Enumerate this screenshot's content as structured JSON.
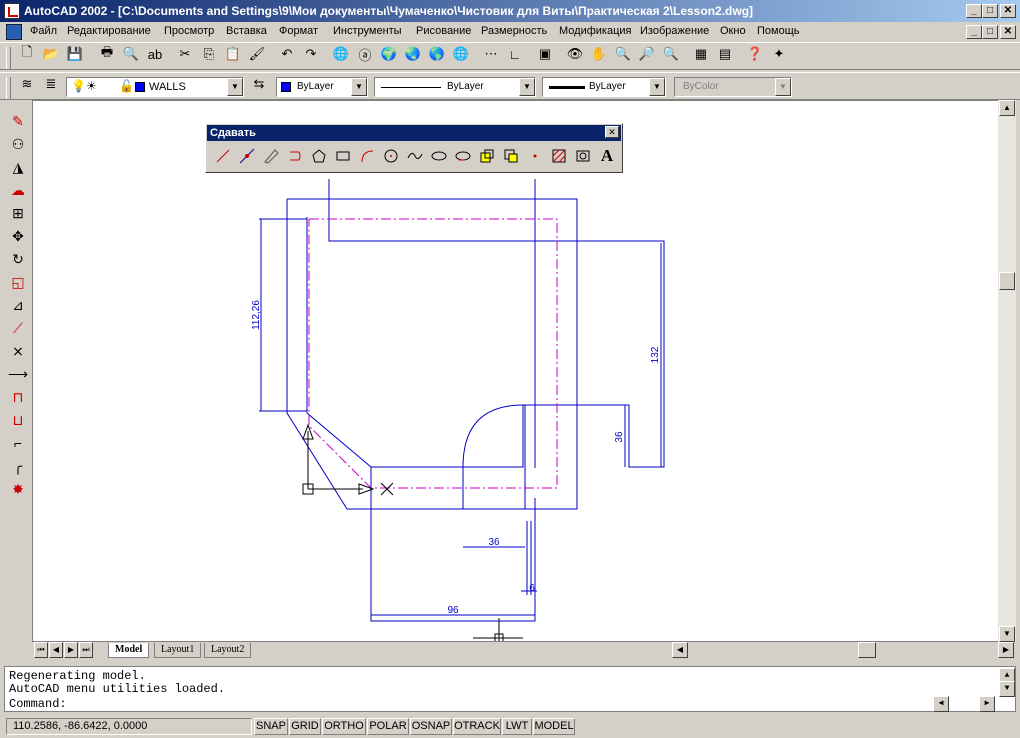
{
  "window": {
    "title": "AutoCAD 2002 - [C:\\Documents and Settings\\9\\Мои документы\\Чумаченко\\Чистовик для Виты\\Практическая 2\\Lesson2.dwg]",
    "controls": [
      "_",
      "□",
      "✕"
    ]
  },
  "menu": [
    "Файл",
    "Редактирование",
    "Просмотр",
    "Вставка",
    "Формат",
    "Инструменты",
    "Рисование",
    "Размерность",
    "Модификация",
    "Изображение",
    "Окно",
    "Помощь"
  ],
  "properties": {
    "layer": "WALLS",
    "color": "ByLayer",
    "linetype": "ByLayer",
    "lineweight": "ByLayer",
    "plotstyle": "ByColor",
    "layer_color": "#0000ff"
  },
  "draw_toolbar": {
    "title": "Сдавать",
    "close": "✕",
    "text_icon": "A",
    "tools": [
      "line-icon",
      "construction-line-icon",
      "polyline-icon",
      "polygon-back-icon",
      "polygon-icon",
      "rectangle-icon",
      "arc-icon",
      "circle-icon",
      "spline-icon",
      "ellipse-icon",
      "revision-cloud-icon",
      "insert-block-icon",
      "make-block-icon",
      "point-icon",
      "hatch-icon",
      "region-icon",
      "text-icon"
    ]
  },
  "drawing": {
    "dims": {
      "d1": "112,26",
      "d2": "132",
      "d3": "36",
      "d4": "36",
      "d5": "6",
      "d6": "96"
    },
    "colors": {
      "outline": "#0000c8",
      "centerline": "#c800c8",
      "dim": "#0000c8"
    }
  },
  "tabs": [
    "Model",
    "Layout1",
    "Layout2"
  ],
  "active_tab": "Model",
  "command": {
    "lines": [
      "Regenerating model.",
      "AutoCAD menu utilities loaded."
    ],
    "prompt": "Command:"
  },
  "status": {
    "coords": "110.2586, -86.6422, 0.0000",
    "toggles": [
      "SNAP",
      "GRID",
      "ORTHO",
      "POLAR",
      "OSNAP",
      "OTRACK",
      "LWT",
      "MODEL"
    ]
  }
}
